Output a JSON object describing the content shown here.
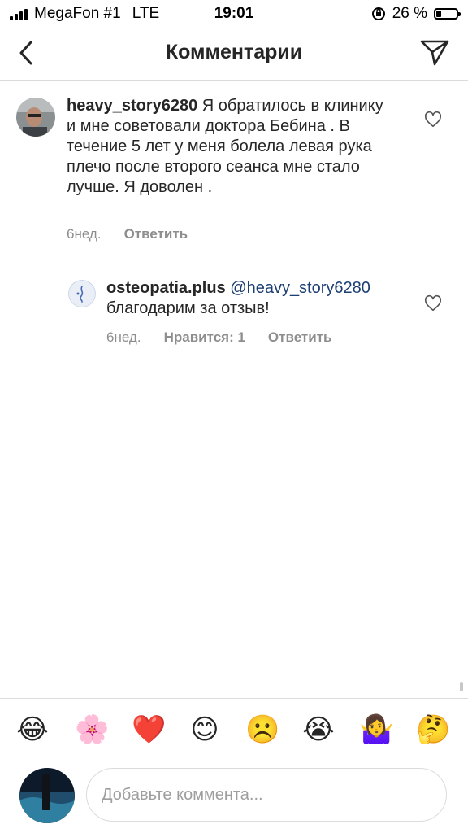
{
  "status_bar": {
    "carrier": "MegaFon #1",
    "network": "LTE",
    "time": "19:01",
    "battery_percent": "26 %",
    "battery_level": 0.26
  },
  "header": {
    "title": "Комментарии",
    "back_icon": "chevron-left-icon",
    "send_icon": "paper-plane-icon"
  },
  "comments": [
    {
      "username": "heavy_story6280",
      "text": "Я обратилось в клинику и мне советовали  доктора Бебина . В течение 5 лет у меня болела левая рука плечо после второго сеанса мне стало лучше. Я доволен .",
      "time": "6нед.",
      "reply_label": "Ответить"
    },
    {
      "username": "osteopatia.plus",
      "mention": "@heavy_story6280",
      "text": "благодарим за отзыв!",
      "time": "6нед.",
      "likes_label": "Нравится: 1",
      "reply_label": "Ответить"
    }
  ],
  "emoji_bar": [
    "😂",
    "🌸",
    "❤️",
    "😊",
    "☹️",
    "😭",
    "🤷‍♀️",
    "🤔"
  ],
  "composer": {
    "placeholder": "Добавьте коммента..."
  },
  "colors": {
    "text": "#262626",
    "meta": "#8e8e8e",
    "mention": "#1c3f73",
    "divider": "#dbdbdb"
  }
}
